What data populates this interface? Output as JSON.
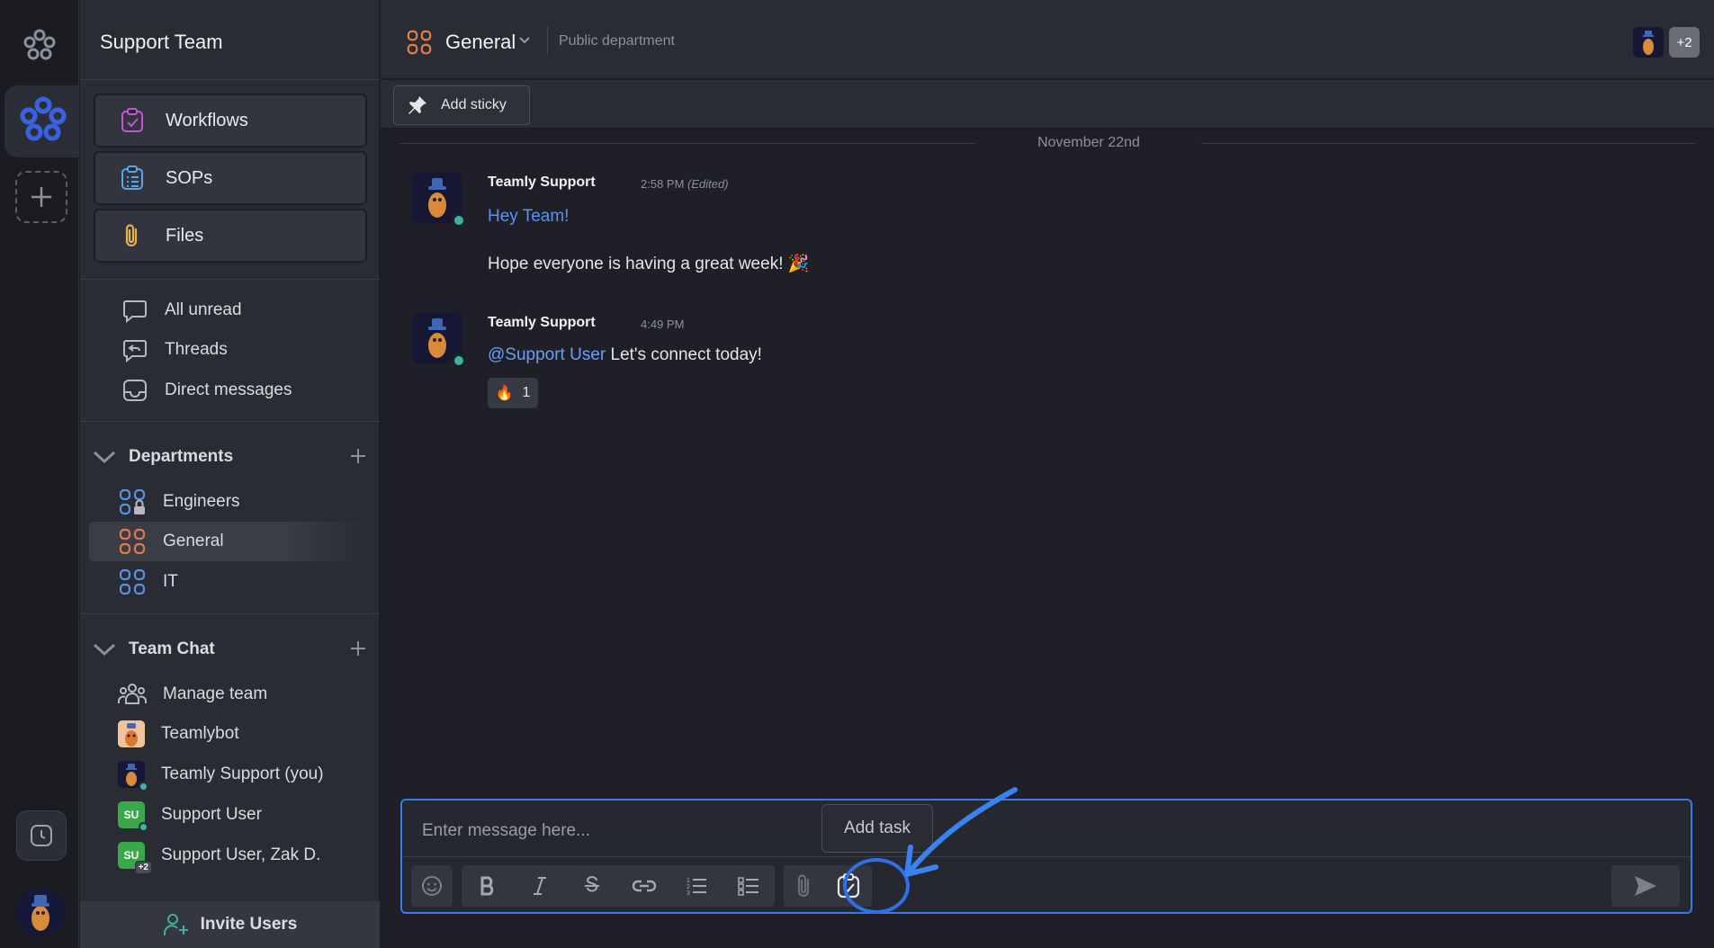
{
  "workspace": {
    "team_name": "Support Team"
  },
  "quick_links": [
    {
      "label": "Workflows",
      "icon": "clipboard-check-icon"
    },
    {
      "label": "SOPs",
      "icon": "clipboard-list-icon"
    },
    {
      "label": "Files",
      "icon": "paperclip-icon"
    }
  ],
  "nav": [
    {
      "label": "All unread",
      "icon": "chat-bubble-icon"
    },
    {
      "label": "Threads",
      "icon": "thread-reply-icon"
    },
    {
      "label": "Direct messages",
      "icon": "inbox-icon"
    }
  ],
  "departments": {
    "title": "Departments",
    "items": [
      {
        "label": "Engineers",
        "locked": true
      },
      {
        "label": "General",
        "active": true
      },
      {
        "label": "IT"
      }
    ]
  },
  "team_chat": {
    "title": "Team Chat",
    "items": [
      {
        "label": "Manage team"
      },
      {
        "label": "Teamlybot"
      },
      {
        "label": "Teamly Support (you)"
      },
      {
        "label": "Support User",
        "initials": "SU"
      },
      {
        "label": "Support User, Zak D.",
        "initials": "SU",
        "extra": "+2"
      }
    ]
  },
  "invite": {
    "label": "Invite Users"
  },
  "channel": {
    "name": "General",
    "description": "Public department",
    "member_overflow": "+2",
    "sticky_label": "Add sticky"
  },
  "date_divider": "November 22nd",
  "messages": [
    {
      "author": "Teamly Support",
      "time": "2:58 PM",
      "edited": "(Edited)",
      "line1": "Hey Team!",
      "line2": "Hope everyone is having a great week! 🎉"
    },
    {
      "author": "Teamly Support",
      "time": "4:49 PM",
      "mention": "@Support User",
      "text": "Let's connect today!",
      "reaction_emoji": "🔥",
      "reaction_count": "1"
    }
  ],
  "composer": {
    "placeholder": "Enter message here...",
    "tooltip": "Add task"
  },
  "colors": {
    "accent": "#3c78e8",
    "department_orange": "#e07b4c",
    "department_blue": "#5b8fe0",
    "online": "#3ab4a0"
  }
}
